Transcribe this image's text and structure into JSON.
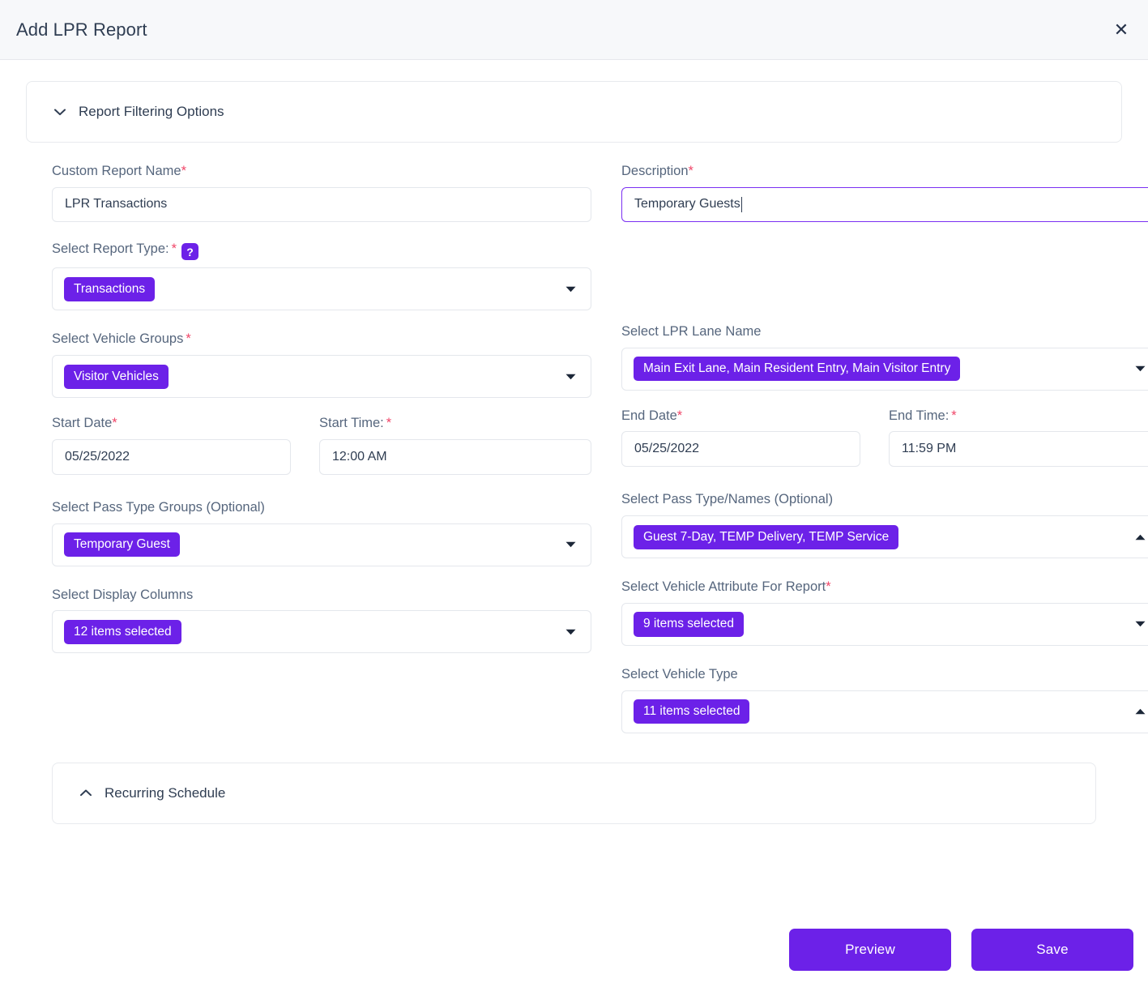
{
  "header": {
    "title": "Add LPR Report",
    "close_label": "✕"
  },
  "accordions": {
    "filtering": {
      "label": "Report Filtering Options",
      "state": "expanded",
      "icon": "chevron-down-icon"
    },
    "recurring": {
      "label": "Recurring Schedule",
      "state": "collapsed",
      "icon": "chevron-up-icon"
    }
  },
  "form": {
    "custom_report_name": {
      "label": "Custom Report Name",
      "required_mark": "*",
      "value": "LPR Transactions"
    },
    "description": {
      "label": "Description",
      "required_mark": "*",
      "value": "Temporary Guests",
      "focused": true
    },
    "report_type": {
      "label": "Select Report Type:",
      "required_mark": "*",
      "help_icon": "?",
      "chip": "Transactions",
      "arrow": "▾"
    },
    "vehicle_groups": {
      "label": "Select Vehicle Groups",
      "required_mark": "*",
      "chip": "Visitor Vehicles",
      "arrow": "▾"
    },
    "lpr_lane_name": {
      "label": "Select LPR Lane Name",
      "chip": "Main Exit Lane, Main Resident Entry, Main Visitor Entry",
      "arrow": "▾"
    },
    "start_date": {
      "label": "Start Date",
      "required_mark": "*",
      "value": "05/25/2022"
    },
    "start_time": {
      "label": "Start Time:",
      "required_mark": "*",
      "value": "12:00 AM"
    },
    "end_date": {
      "label": "End Date",
      "required_mark": "*",
      "value": "05/25/2022"
    },
    "end_time": {
      "label": "End Time:",
      "required_mark": "*",
      "value": "11:59 PM"
    },
    "pass_type_groups": {
      "label": "Select Pass Type Groups (Optional)",
      "chip": "Temporary Guest",
      "arrow": "▾"
    },
    "pass_type_names": {
      "label": "Select Pass Type/Names (Optional)",
      "chip": "Guest 7-Day, TEMP Delivery, TEMP Service",
      "arrow": "▴"
    },
    "display_columns": {
      "label": "Select Display Columns",
      "chip": "12 items selected",
      "arrow": "▾"
    },
    "vehicle_attribute": {
      "label": "Select Vehicle Attribute For Report",
      "required_mark": "*",
      "chip": "9 items selected",
      "arrow": "▾"
    },
    "vehicle_type": {
      "label": "Select Vehicle Type",
      "chip": "11 items selected",
      "arrow": "▴"
    }
  },
  "footer": {
    "preview_label": "Preview",
    "save_label": "Save"
  },
  "colors": {
    "accent": "#6c21e8",
    "focus_border": "#7b2ff2",
    "required": "#f04668",
    "header_bg": "#f7f8fa",
    "label_text": "#56667d",
    "title_text": "#2f3d52"
  }
}
